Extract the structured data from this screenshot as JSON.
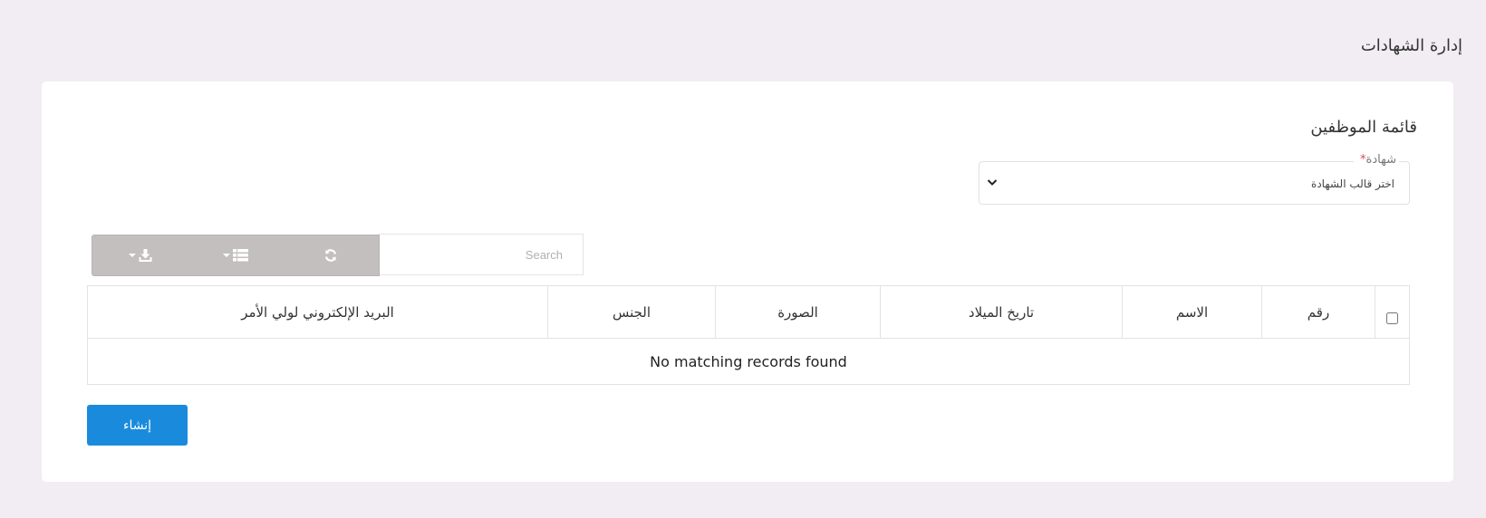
{
  "page": {
    "title": "إدارة الشهادات"
  },
  "card": {
    "title": "قائمة الموظفين",
    "certificate_field": {
      "label": "شهادة",
      "required_mark": "*",
      "selected": "اختر قالب الشهادة"
    },
    "search": {
      "placeholder": "Search"
    },
    "toolbar": {
      "icons": [
        "refresh-icon",
        "columns-icon",
        "export-icon"
      ]
    },
    "table": {
      "columns": {
        "number": "رقم",
        "name": "الاسم",
        "dob": "تاريخ الميلاد",
        "photo": "الصورة",
        "gender": "الجنس",
        "guardian_email": "البريد الإلكتروني لولي الأمر"
      },
      "empty_message": "No matching records found"
    },
    "create_label": "إنشاء"
  },
  "colors": {
    "background": "#f1edf2",
    "primary": "#1a8bdc",
    "toolbar": "#c3bfbf",
    "required": "#e04b4b"
  }
}
